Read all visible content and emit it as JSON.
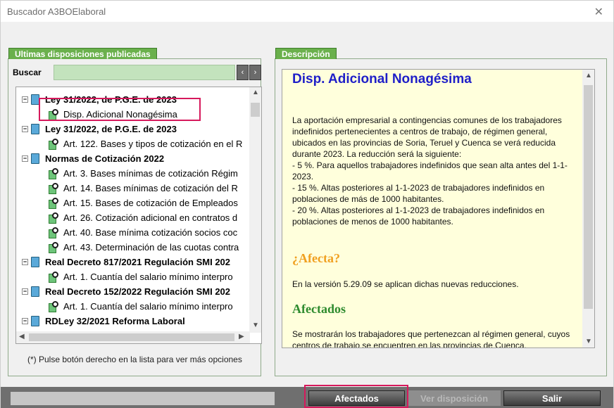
{
  "window": {
    "title": "Buscador A3BOElaboral",
    "close": "✕"
  },
  "left_panel": {
    "header": "Ultimas disposiciones publicadas",
    "search_label": "Buscar",
    "search_value": "",
    "prev": "‹",
    "next": "›"
  },
  "tree": [
    {
      "type": "parent",
      "text": "Ley 31/2022, de P.G.E. de 2023"
    },
    {
      "type": "child",
      "text": "Disp. Adicional Nonagésima",
      "selected": true
    },
    {
      "type": "parent",
      "text": "Ley 31/2022, de P.G.E. de 2023"
    },
    {
      "type": "child",
      "text": "Art. 122. Bases y tipos de cotización en el R"
    },
    {
      "type": "parent",
      "text": "Normas de Cotización 2022"
    },
    {
      "type": "child",
      "text": "Art. 3. Bases mínimas de cotización Régim"
    },
    {
      "type": "child",
      "text": "Art. 14. Bases mínimas de cotización del R"
    },
    {
      "type": "child",
      "text": "Art. 15. Bases de cotización de Empleados"
    },
    {
      "type": "child",
      "text": "Art. 26. Cotización adicional en contratos d"
    },
    {
      "type": "child",
      "text": "Art. 40. Base mínima cotización socios coc"
    },
    {
      "type": "child",
      "text": "Art. 43. Determinación de las cuotas contra"
    },
    {
      "type": "parent",
      "text": "Real Decreto 817/2021 Regulación SMI 202"
    },
    {
      "type": "child",
      "text": "Art. 1. Cuantía del salario mínimo interpro"
    },
    {
      "type": "parent",
      "text": "Real Decreto 152/2022 Regulación SMI 202"
    },
    {
      "type": "child",
      "text": "Art. 1. Cuantía del salario mínimo interpro"
    },
    {
      "type": "parent",
      "text": "RDLey 32/2021 Reforma Laboral"
    }
  ],
  "note": "(*) Pulse botón derecho en la lista para ver más opciones",
  "description": {
    "header": "Descripción",
    "title": "Disp. Adicional Nonagésima",
    "body": "La aportación empresarial a contingencias comunes de los trabajadores indefinidos pertenecientes a centros de trabajo, de régimen general, ubicados en las provincias de Soria, Teruel y Cuenca se verá reducida durante 2023. La reducción será la siguiente:\n- 5 %. Para aquellos trabajadores indefinidos que sean alta antes del 1-1-2023.\n- 15 %. Altas posteriores al 1-1-2023 de trabajadores indefinidos en poblaciones de más de 1000 habitantes.\n- 20 %. Altas posteriores al 1-1-2023 de trabajadores indefinidos en poblaciones de menos de 1000 habitantes.",
    "afecta_heading": "¿Afecta?",
    "afecta_text": "En la versión 5.29.09 se aplican dichas nuevas reducciones.",
    "afectados_heading": "Afectados",
    "afectados_text": "Se mostrarán los trabajadores que pertenezcan al régimen general, cuyos centros de trabajo se encuentren en las provincias de Cuenca,",
    "colors": {
      "title": "#1f1fc8",
      "afecta": "#f0a020",
      "afectados": "#2e8b2e"
    }
  },
  "buttons": {
    "afectados": "Afectados",
    "ver": "Ver disposición",
    "salir": "Salir"
  }
}
